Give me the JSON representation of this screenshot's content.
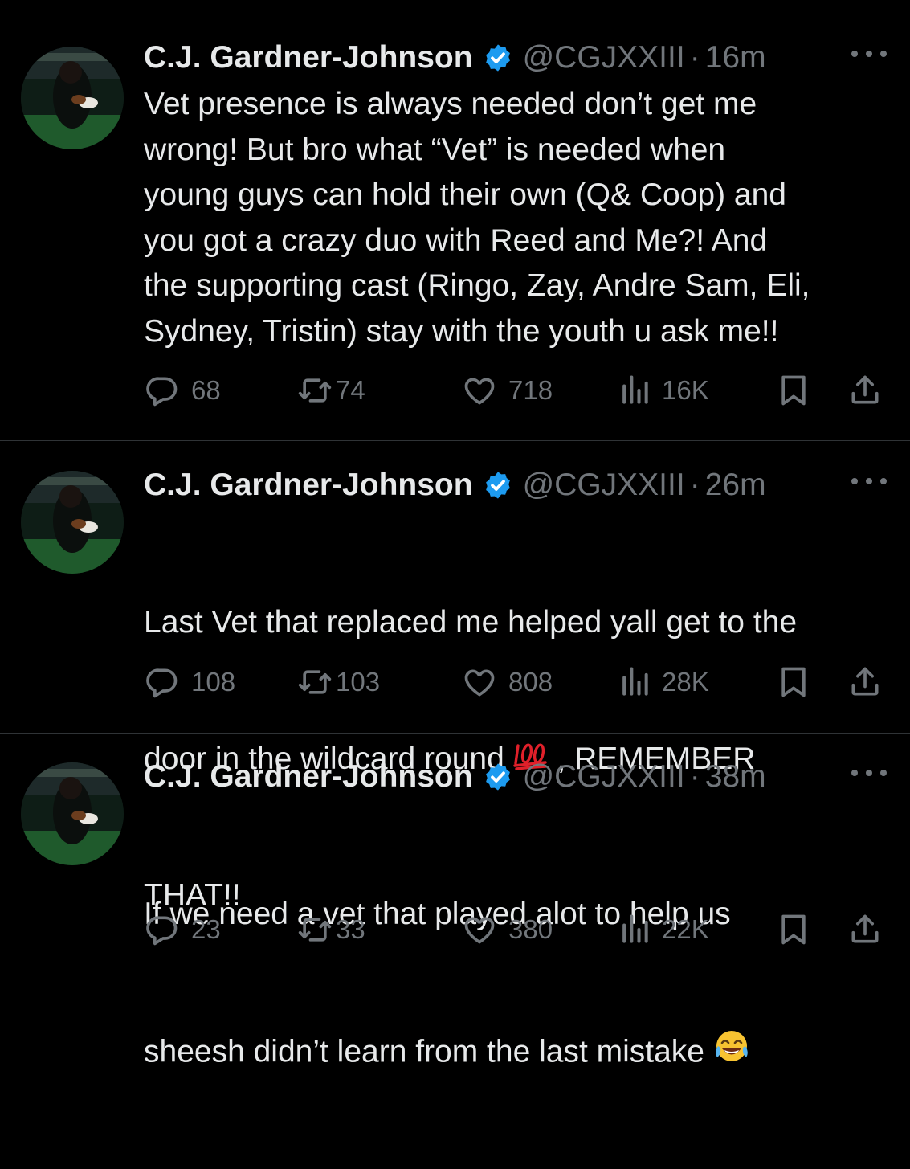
{
  "colors": {
    "background": "#000000",
    "text": "#e7e9ea",
    "muted": "#71767b",
    "verified": "#1d9bf0",
    "divider": "#2f3336"
  },
  "tweets": [
    {
      "name": "C.J. Gardner-Johnson",
      "handle": "@CGJXXIII",
      "dot": "·",
      "time": "16m",
      "text": "Vet presence is always needed don’t get me\nwrong! But bro what “Vet” is needed when\nyoung guys can hold their own (Q& Coop) and\nyou got a crazy duo with Reed and Me?! And\nthe supporting cast (Ringo, Zay, Andre Sam, Eli,\nSydney, Tristin) stay with the youth u ask me!!",
      "replies": "68",
      "reposts": "74",
      "likes": "718",
      "views": "16K"
    },
    {
      "name": "C.J. Gardner-Johnson",
      "handle": "@CGJXXIII",
      "dot": "·",
      "time": "26m",
      "text_line1": "Last Vet that replaced me helped yall get to the",
      "text_line2_a": "door in the wildcard round ",
      "text_line2_emoji": "💯",
      "text_line2_b": " , REMEMBER",
      "text_line3": "THAT!!",
      "replies": "108",
      "reposts": "103",
      "likes": "808",
      "views": "28K"
    },
    {
      "name": "C.J. Gardner-Johnson",
      "handle": "@CGJXXIII",
      "dot": "·",
      "time": "38m",
      "text_line1": "If we need a vet that played alot to help us",
      "text_line2_a": "sheesh didn’t learn from the last mistake ",
      "text_line2_emoji": "😂",
      "replies": "23",
      "reposts": "33",
      "likes": "380",
      "views": "22K"
    }
  ],
  "icons": [
    "reply-icon",
    "repost-icon",
    "like-icon",
    "views-icon",
    "bookmark-icon",
    "share-icon",
    "verified-badge-icon",
    "more-icon"
  ]
}
